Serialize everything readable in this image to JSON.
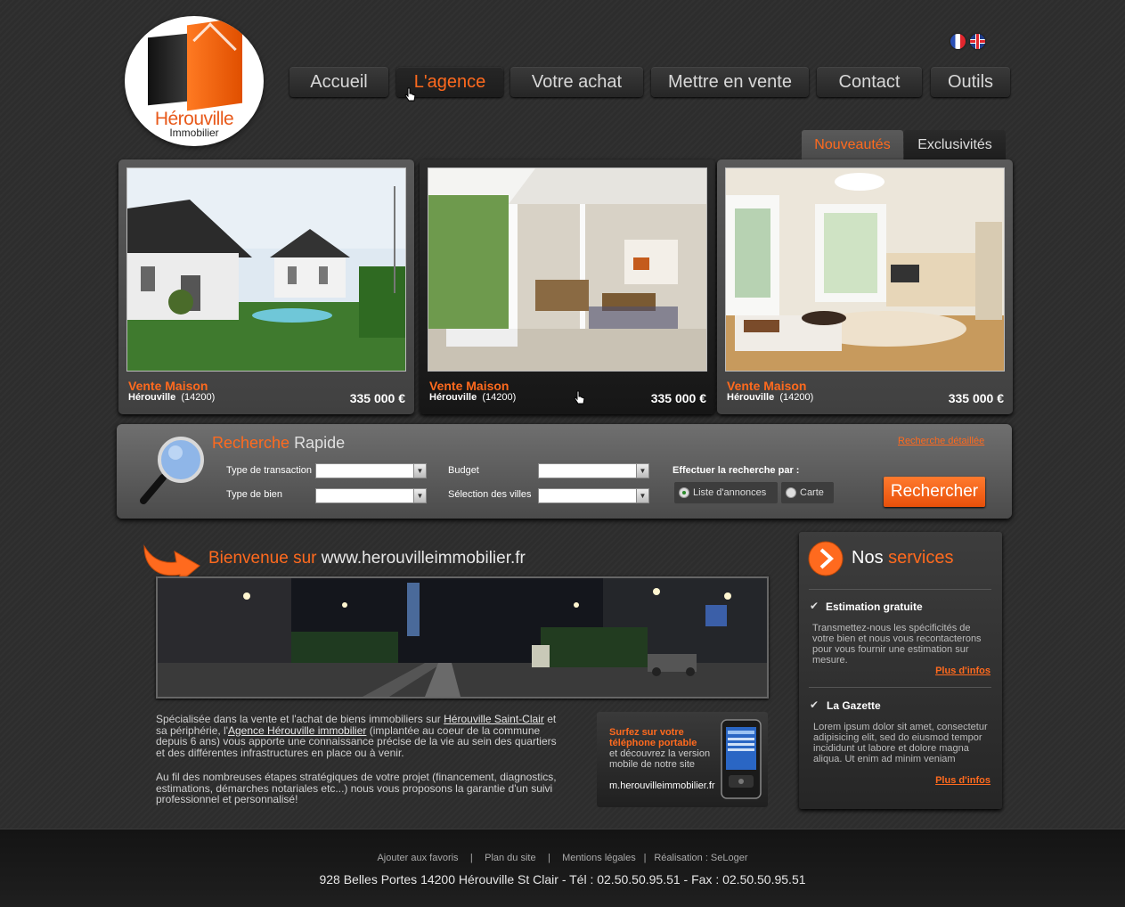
{
  "logo": {
    "name": "Hérouville",
    "sub": "Immobilier"
  },
  "nav": [
    "Accueil",
    "L'agence",
    "Votre achat",
    "Mettre en vente",
    "Contact",
    "Outils"
  ],
  "tabs": [
    "Nouveautés",
    "Exclusivités"
  ],
  "listings": [
    {
      "title": "Vente Maison",
      "city": "Hérouville",
      "zip": "(14200)",
      "price": "335 000 €"
    },
    {
      "title": "Vente Maison",
      "city": "Hérouville",
      "zip": "(14200)",
      "price": "335 000 €"
    },
    {
      "title": "Vente Maison",
      "city": "Hérouville",
      "zip": "(14200)",
      "price": "335 000 €"
    }
  ],
  "search": {
    "title_a": "Recherche",
    "title_b": "Rapide",
    "advanced_link": "Recherche détaillée",
    "labels": {
      "transaction": "Type de transaction",
      "property": "Type de bien",
      "budget": "Budget",
      "cities": "Sélection des villes",
      "mode": "Effectuer la recherche par :"
    },
    "modes": [
      "Liste d'annonces",
      "Carte"
    ],
    "button": "Rechercher"
  },
  "welcome": {
    "title_a": "Bienvenue sur",
    "title_b": "www.herouvilleimmobilier.fr",
    "p1": [
      "Spécialisée dans la vente et l'achat de biens immobiliers sur ",
      "Hérouville Saint-Clair",
      " et",
      "sa périphérie, l'",
      "Agence Hérouville immobilier",
      " (implantée au coeur de la commune",
      "depuis 6 ans) vous apporte une connaissance précise de la vie au sein des quartiers",
      "et des différentes infrastructures en place ou à venir."
    ],
    "p2": [
      "Au fil des nombreuses étapes stratégiques de votre projet (financement, diagnostics,",
      "estimations, démarches notariales etc...) nous vous proposons la garantie d'un suivi",
      "professionnel et personnalisé!"
    ]
  },
  "mobile": {
    "title1": "Surfez sur votre",
    "title2": "téléphone portable",
    "text1": "et découvrez la version",
    "text2": "mobile de notre site",
    "url": "m.herouvilleimmobilier.fr"
  },
  "services": {
    "title_a": "Nos",
    "title_b": "services",
    "items": [
      {
        "title": "Estimation gratuite",
        "lines": [
          "Transmettez-nous les spécificités de",
          "votre bien et nous vous recontacterons",
          "pour vous fournir une estimation sur",
          "mesure."
        ],
        "more": "Plus d'infos"
      },
      {
        "title": "La Gazette",
        "lines": [
          "Lorem ipsum dolor sit amet, consectetur",
          "adipisicing elit, sed do eiusmod tempor",
          "incididunt ut labore et dolore magna",
          "aliqua. Ut enim ad minim veniam"
        ],
        "more": "Plus d'infos"
      }
    ]
  },
  "footer": {
    "links": [
      "Ajouter aux favoris",
      "Plan du site",
      "Mentions légales",
      "Réalisation : SeLoger"
    ],
    "separator": "|",
    "address": "928 Belles Portes 14200 Hérouville St Clair - Tél : 02.50.50.95.51 - Fax : 02.50.50.95.51"
  },
  "colors": {
    "accent": "#ff6a1e",
    "background": "#2d2d2d",
    "footer": "#1a1a1a"
  }
}
